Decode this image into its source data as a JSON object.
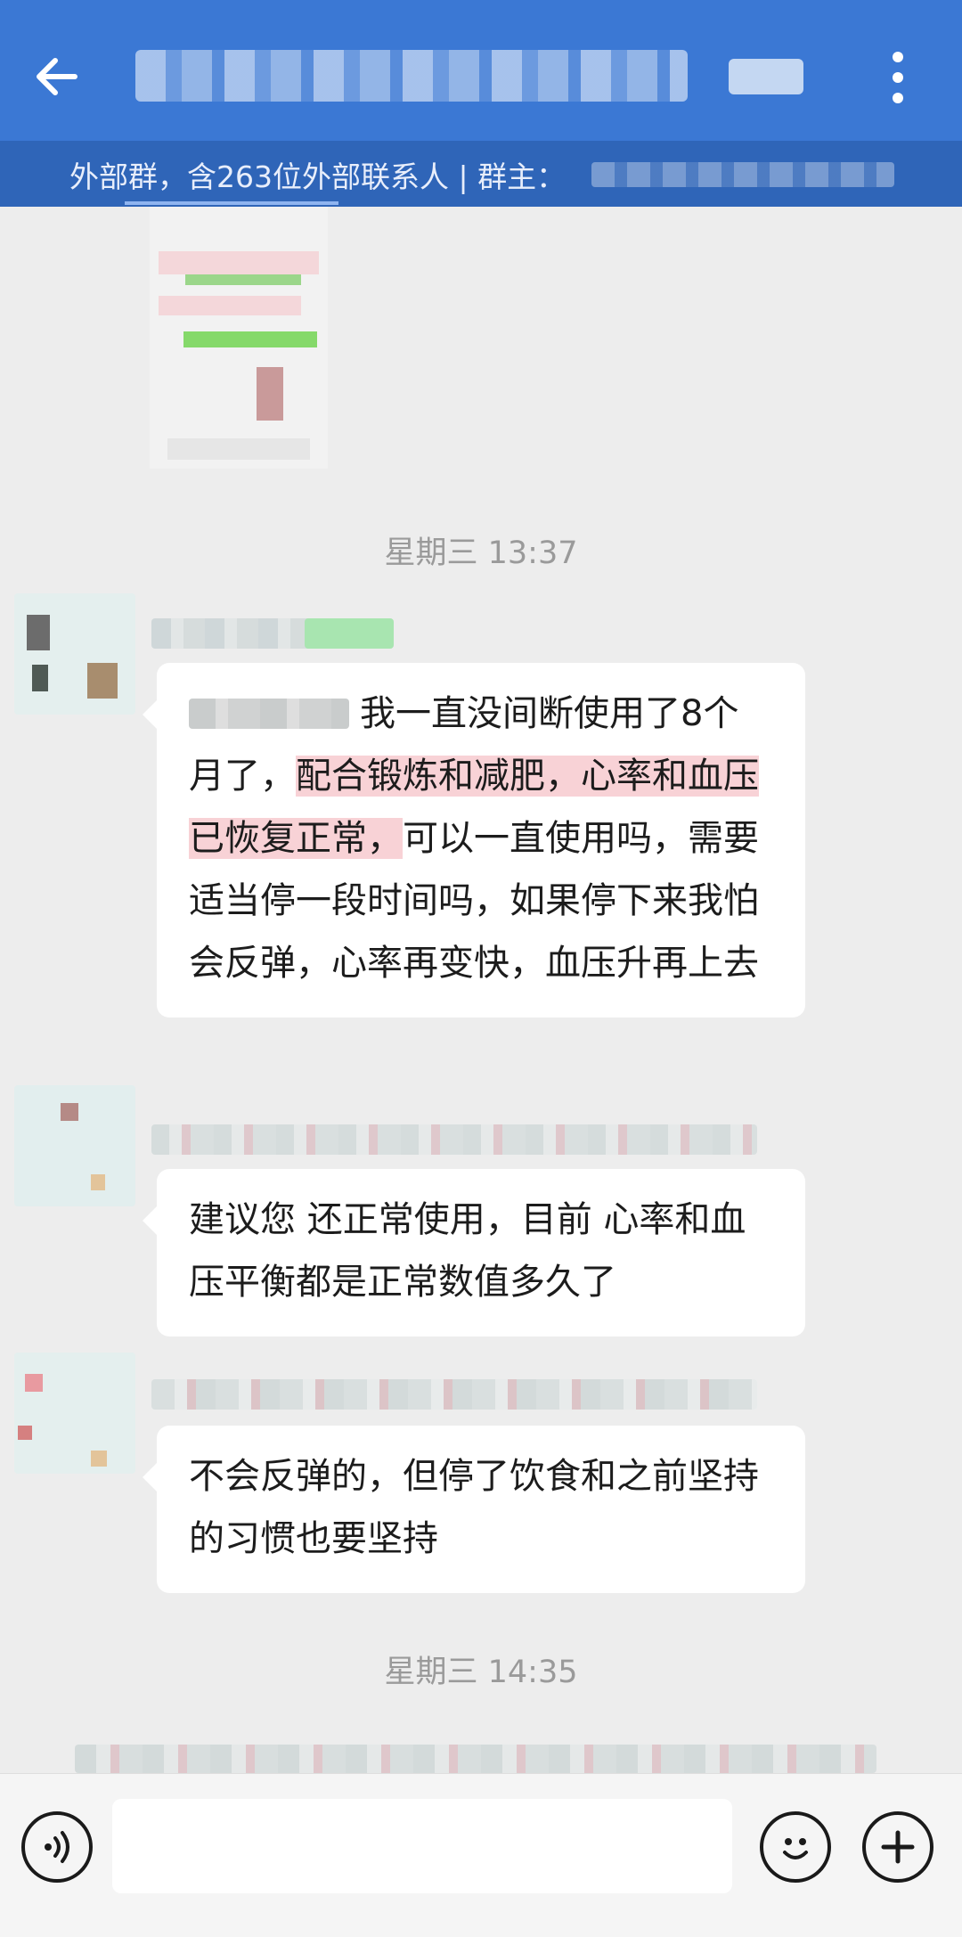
{
  "header": {
    "title": "",
    "subtitle_prefix": "外部群，含263位外部联系人 | 群主："
  },
  "messages": [
    {
      "time": "星期三  13:37",
      "segments": [
        "我一直没间断使用了8个月了，",
        "配合锻炼和减肥，心率和血压已恢复正常，",
        "可以一直使用吗，需要适当停一段时间吗，如果停下来我怕会反弹，心率再变快，血压升再上去"
      ]
    },
    {
      "text": "建议您 还正常使用，目前 心率和血压平衡都是正常数值多久了"
    },
    {
      "text": "不会反弹的，但停了饮食和之前坚持的习惯也要坚持"
    }
  ],
  "time_divider_2": "星期三  14:35",
  "composer": {
    "placeholder": ""
  },
  "icons": {
    "back": "back-arrow-icon",
    "more": "more-vertical-icon",
    "voice": "voice-icon",
    "emoji": "emoji-icon",
    "plus": "plus-icon"
  },
  "colors": {
    "header_bg": "#3b78d4",
    "subheader_bg": "#2f65b8",
    "highlight": "#f8d2d6"
  }
}
